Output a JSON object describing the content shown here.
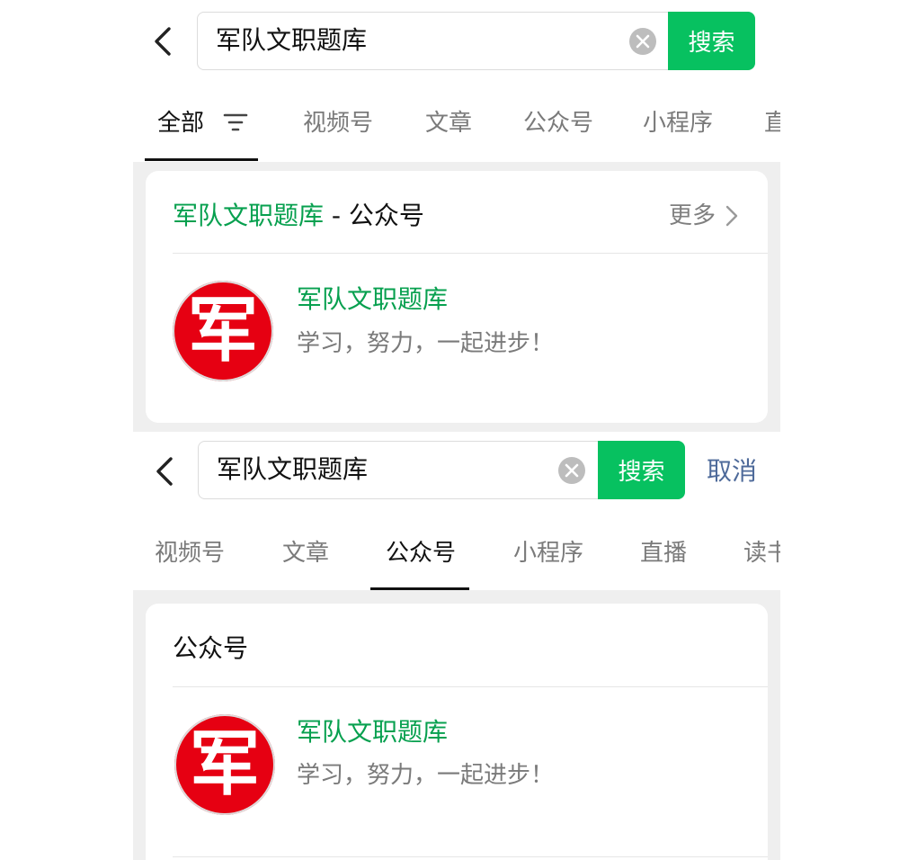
{
  "panel1": {
    "search": {
      "query": "军队文职题库",
      "button": "搜索"
    },
    "tabs": [
      "全部",
      "视频号",
      "文章",
      "公众号",
      "小程序",
      "直"
    ],
    "card": {
      "title_highlight": "军队文职题库",
      "title_rest": " - 公众号",
      "more": "更多",
      "account": {
        "avatar_char": "军",
        "name": "军队文职题库",
        "desc": "学习，努力，一起进步！"
      }
    }
  },
  "panel2": {
    "search": {
      "query": "军队文职题库",
      "button": "搜索",
      "cancel": "取消"
    },
    "tabs": [
      "视频号",
      "文章",
      "公众号",
      "小程序",
      "直播",
      "读书"
    ],
    "card": {
      "title": "公众号",
      "account": {
        "avatar_char": "军",
        "name": "军队文职题库",
        "desc": "学习，努力，一起进步！"
      }
    }
  },
  "colors": {
    "accent": "#07c160",
    "highlight": "#07a04f",
    "avatar": "#e60012",
    "link": "#4e6a9a"
  },
  "icons": [
    "back-arrow-icon",
    "clear-icon",
    "filter-icon",
    "chevron-right-icon"
  ]
}
